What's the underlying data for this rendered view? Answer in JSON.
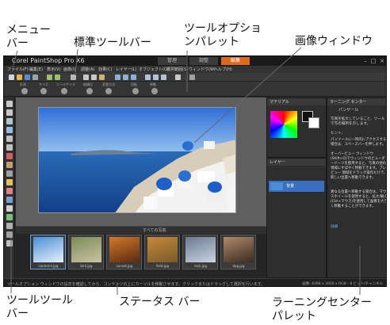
{
  "callouts": {
    "menubar": "メニュー\nバー",
    "standard_toolbar": "標準ツールバー",
    "tool_options": "ツールオプショ\nンパレット",
    "image_window": "画像ウィンドウ",
    "tools_toolbar": "ツールツール\nバー",
    "status_bar": "ステータス バー",
    "learning_center": "ラーニングセンター\nパレット"
  },
  "app": {
    "title": "Corel PaintShop Pro X6",
    "tabs": [
      "管理",
      "調整",
      "編集"
    ],
    "active_tab": 2
  },
  "menu": [
    "ファイル(F)",
    "編集(E)",
    "表示(V)",
    "画像(I)",
    "調整(A)",
    "効果(C)",
    "レイヤー(L)",
    "オブジェクト(O)",
    "選択範囲(S)",
    "ウィンドウ(W)",
    "ヘルプ(H)"
  ],
  "options": [
    "形状",
    "サイズ",
    "ツールサイズ",
    "縦横比",
    "変更方法",
    "回転",
    "移動"
  ],
  "organizer": {
    "label": "すべての写真",
    "thumbs": [
      {
        "name": "santorini.jpg",
        "colors": [
          "#4a8fd6",
          "#e8f0fa"
        ]
      },
      {
        "name": "bird.jpg",
        "colors": [
          "#7c8a5a",
          "#c9c4a2"
        ]
      },
      {
        "name": "sunset.jpg",
        "colors": [
          "#d27a2a",
          "#5a2a10"
        ]
      },
      {
        "name": "field.jpg",
        "colors": [
          "#c58a3a",
          "#7a5a2a"
        ]
      },
      {
        "name": "rock.jpg",
        "colors": [
          "#6a7a90",
          "#c9d4e0"
        ]
      },
      {
        "name": "dog.jpg",
        "colors": [
          "#b08a6a",
          "#3a2a20"
        ]
      }
    ]
  },
  "materials": {
    "title": "マテリアル"
  },
  "layers": {
    "title": "レイヤー",
    "layer_name": "背景"
  },
  "learning_center": {
    "title": "ラーニング センター",
    "section": "パンゲール",
    "intro": "写真を拡大していること、ツールで写の場所を示します。",
    "hint_label": "ヒント:",
    "bullets": [
      "パンツールに一時的にアクセスする場合は、スペースバーを押します。",
      "オーバービュー ウィンドウ(Shift+O)でウィンドウのビューボードーツを使用すると、写真の他の領域にすばやく移動できます。ブレビュー 領域をドラッグ操作だけで、新しい位置へ移動できます。",
      "異なる位置へ移動する場合は、マウスホイールを使用すると、拡大/縮小(Ctrl+マウス)を使用して画像を大きく移動することができます。"
    ],
    "link": "詳細"
  },
  "status": {
    "left": "ツールオプション ウィンドウの設定を確認してから、コンテンツの上にカーソルを移動させます。クリックまたはドラッグして選択を行います。",
    "right": "画像: 4398 x 3000 x RGB - 8 ビット/チャンネル"
  }
}
